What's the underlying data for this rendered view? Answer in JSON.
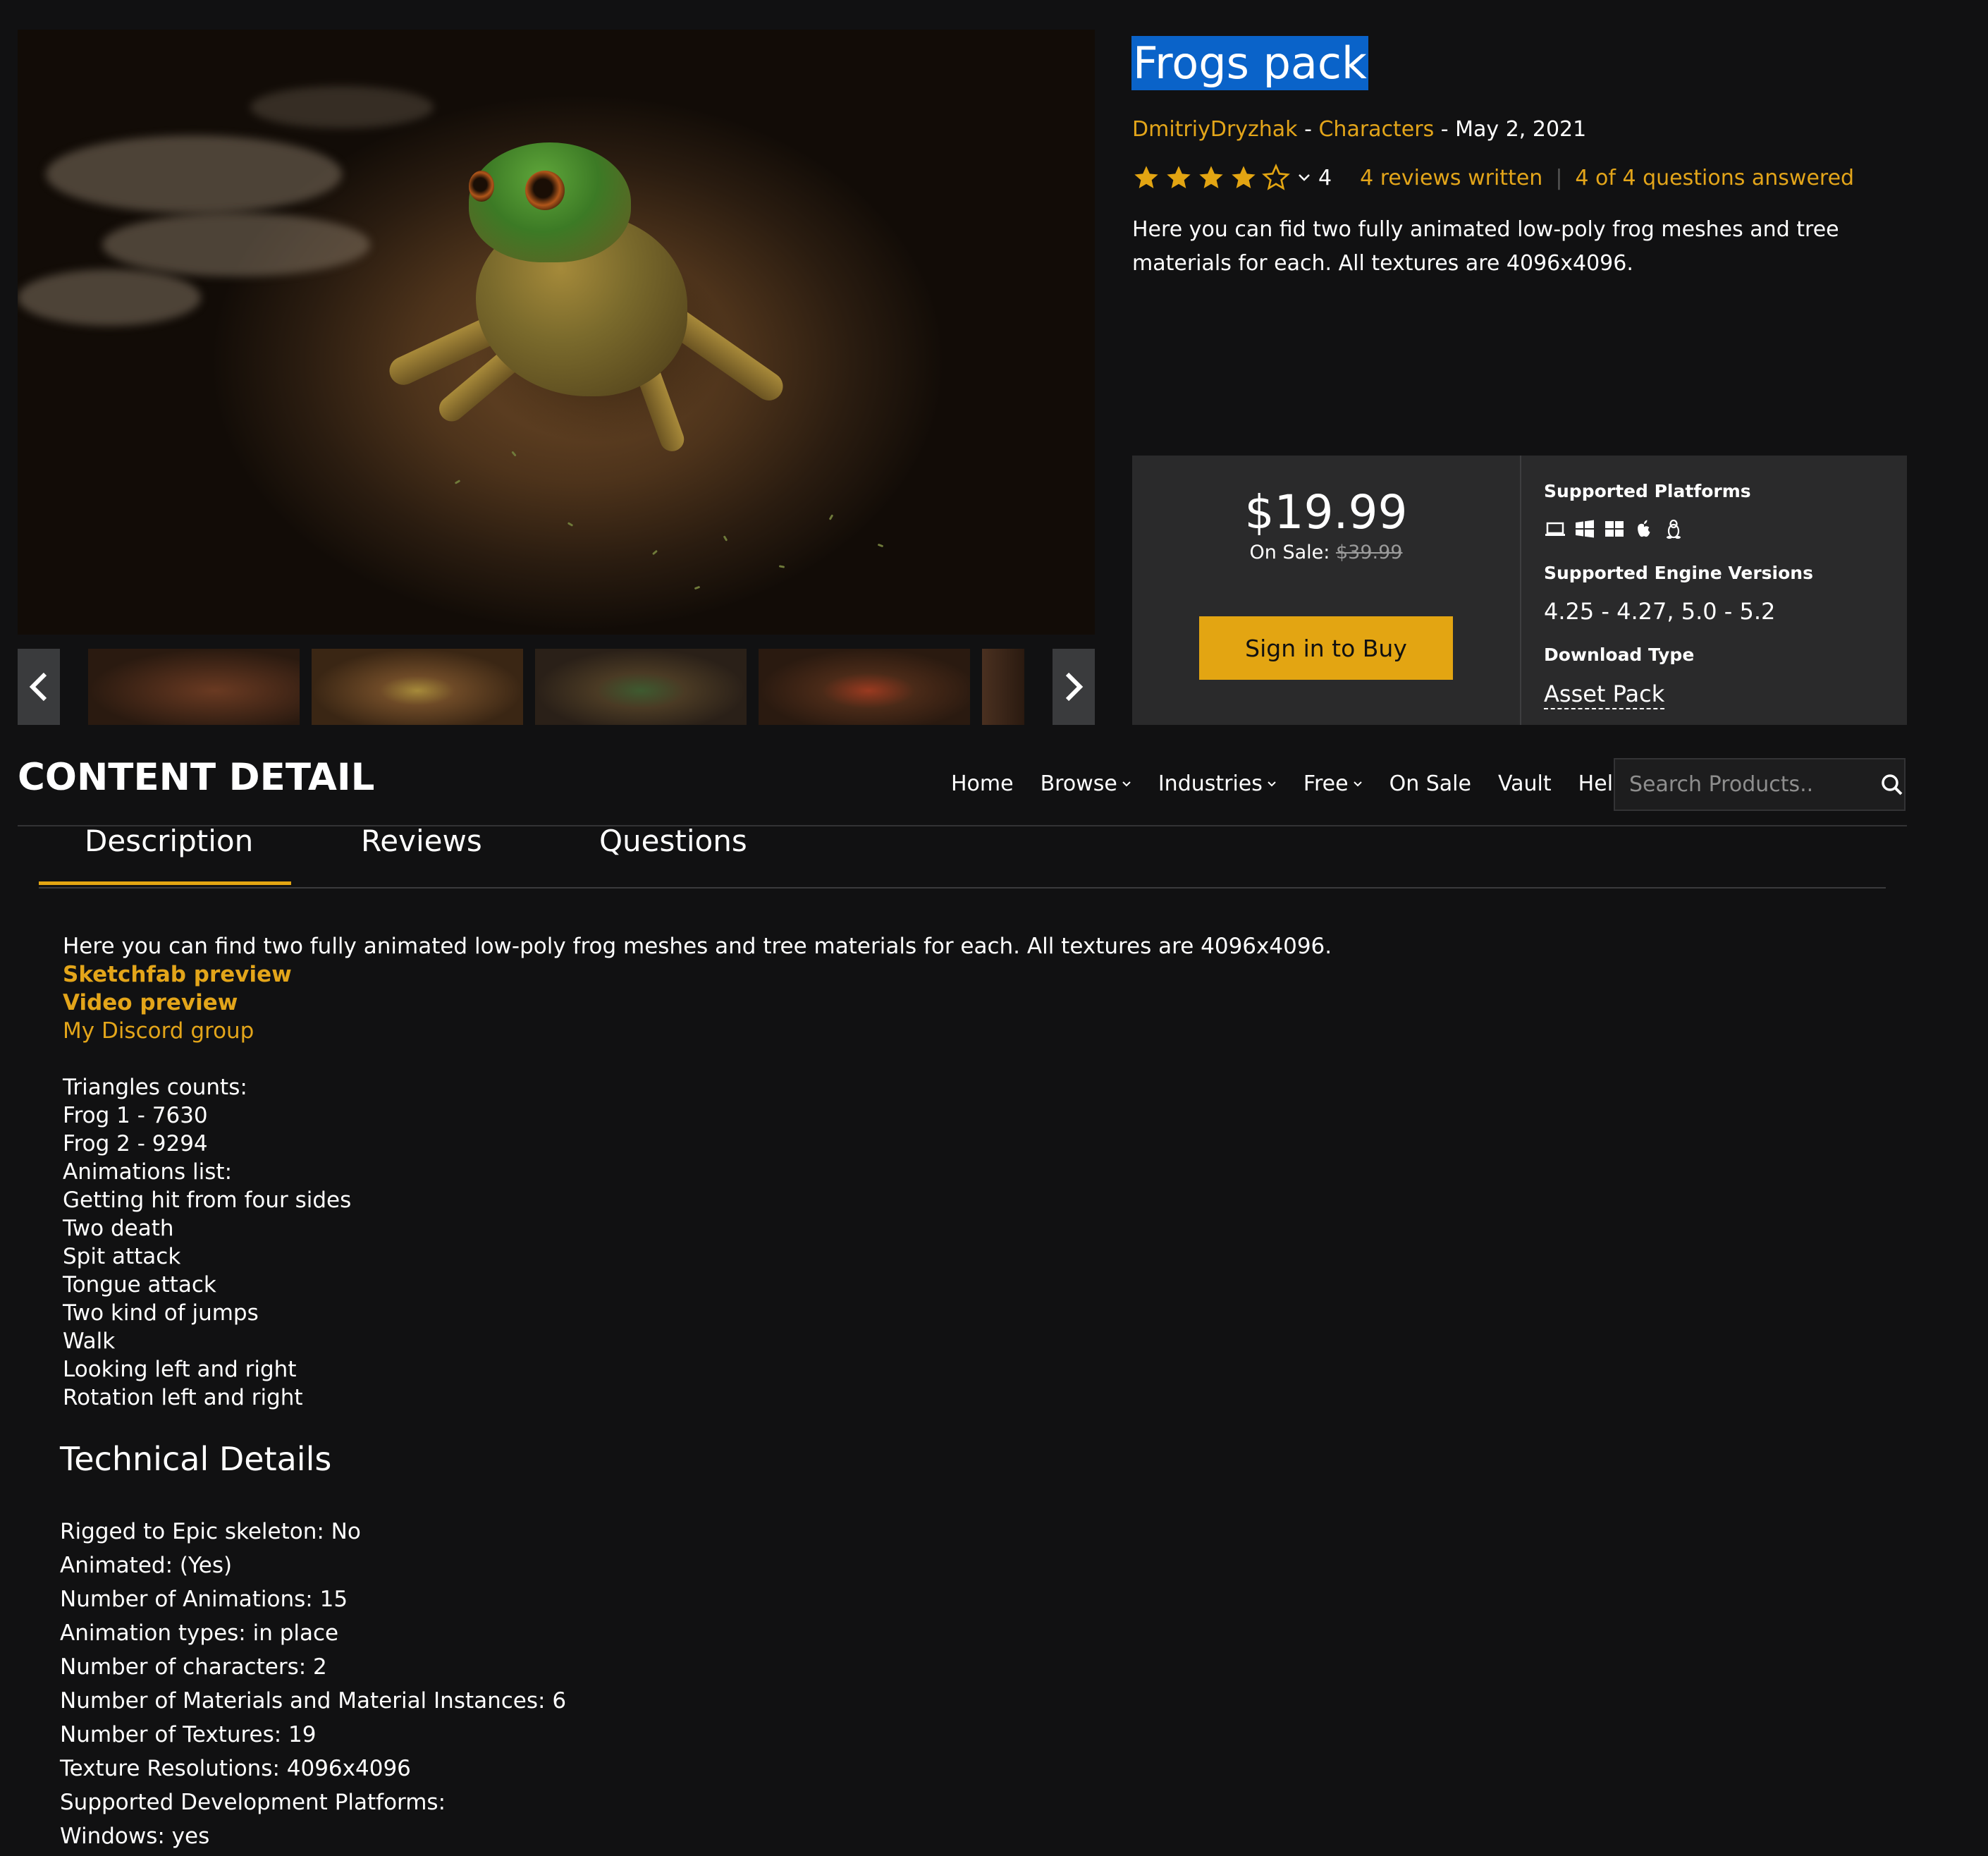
{
  "product": {
    "title": "Frogs pack",
    "author": "DmitriyDryzhak",
    "category": "Characters",
    "date": "May 2, 2021",
    "dash": "-",
    "rating_count": "4",
    "reviews_link": "4 reviews written",
    "questions_link": "4 of 4 questions answered",
    "rating_value": 4,
    "short_description": "Here you can fid two fully animated low-poly frog meshes and tree materials for each. All textures are 4096x4096."
  },
  "purchase": {
    "price": "$19.99",
    "on_sale_label": "On Sale:",
    "old_price": "$39.99",
    "buy_button": "Sign in to Buy"
  },
  "specs": {
    "platforms_label": "Supported Platforms",
    "platform_icons": [
      "laptop-icon",
      "windows-icon",
      "windows-icon",
      "apple-icon",
      "linux-icon"
    ],
    "engine_label": "Supported Engine Versions",
    "engine_value": "4.25 - 4.27, 5.0 - 5.2",
    "download_label": "Download Type",
    "download_value": "Asset Pack"
  },
  "nav": {
    "section_title": "CONTENT DETAIL",
    "items": [
      "Home",
      "Browse",
      "Industries",
      "Free",
      "On Sale",
      "Vault",
      "Help"
    ],
    "search_placeholder": "Search Products.."
  },
  "tabs": [
    "Description",
    "Reviews",
    "Questions"
  ],
  "description": {
    "intro": "Here you can find two fully animated low-poly frog meshes and tree materials for each. All textures are 4096x4096.",
    "link1": "Sketchfab preview",
    "link2": "Video preview",
    "link3": "My Discord group",
    "lines": [
      "Triangles counts:",
      "Frog 1 - 7630",
      "Frog 2 - 9294",
      "Animations list:",
      "Getting hit from four sides",
      "Two death",
      "Spit attack",
      "Tongue attack",
      "Two kind of jumps",
      "Walk",
      "Looking left and right",
      "Rotation left and right"
    ]
  },
  "technical": {
    "title": "Technical Details",
    "lines": [
      "Rigged to Epic skeleton: No",
      "Animated: (Yes)",
      "Number of Animations: 15",
      "Animation types: in place",
      "Number of characters: 2",
      "Number of Materials and Material Instances: 6",
      "Number of Textures: 19",
      "Texture Resolutions: 4096x4096",
      "Supported Development Platforms:",
      "Windows: yes"
    ]
  },
  "colors": {
    "accent": "#e3a512",
    "background": "#111112",
    "panel": "#2a2a2b",
    "selection": "#0a63c9"
  }
}
